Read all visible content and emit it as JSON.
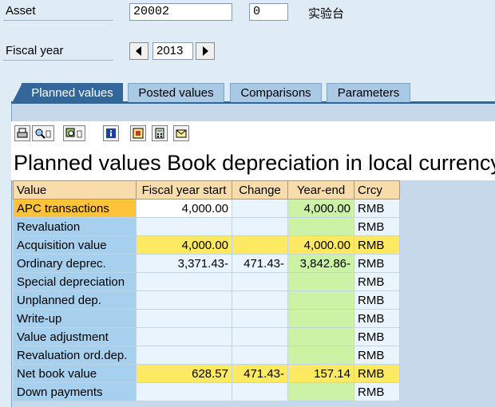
{
  "header": {
    "asset_label": "Asset",
    "asset_number": "20002",
    "sub_number": "0",
    "asset_description": "实验台",
    "fiscal_year_label": "Fiscal year",
    "fiscal_year": "2013"
  },
  "tabs": [
    {
      "label": "Planned values",
      "active": true
    },
    {
      "label": "Posted values",
      "active": false
    },
    {
      "label": "Comparisons",
      "active": false
    },
    {
      "label": "Parameters",
      "active": false
    }
  ],
  "toolbar": {
    "icons": [
      "print-icon",
      "find-icon",
      "find-next-icon",
      "info-icon",
      "export-icon",
      "calculator-icon",
      "mail-icon"
    ]
  },
  "report": {
    "title": "Planned values Book depreciation in local currency"
  },
  "table": {
    "headers": [
      "Value",
      "Fiscal year start",
      "Change",
      "Year-end",
      "Crcy"
    ],
    "rows": [
      {
        "label": "APC transactions",
        "start": "4,000.00",
        "change": "",
        "end": "4,000.00",
        "crcy": "RMB"
      },
      {
        "label": "Revaluation",
        "start": "",
        "change": "",
        "end": "",
        "crcy": "RMB"
      },
      {
        "label": "Acquisition value",
        "start": "4,000.00",
        "change": "",
        "end": "4,000.00",
        "crcy": "RMB"
      },
      {
        "label": "Ordinary deprec.",
        "start": "3,371.43-",
        "change": "471.43-",
        "end": "3,842.86-",
        "crcy": "RMB"
      },
      {
        "label": "Special depreciation",
        "start": "",
        "change": "",
        "end": "",
        "crcy": "RMB"
      },
      {
        "label": "Unplanned dep.",
        "start": "",
        "change": "",
        "end": "",
        "crcy": "RMB"
      },
      {
        "label": "Write-up",
        "start": "",
        "change": "",
        "end": "",
        "crcy": "RMB"
      },
      {
        "label": "Value adjustment",
        "start": "",
        "change": "",
        "end": "",
        "crcy": "RMB"
      },
      {
        "label": "Revaluation ord.dep.",
        "start": "",
        "change": "",
        "end": "",
        "crcy": "RMB"
      },
      {
        "label": "Net book value",
        "start": "628.57",
        "change": "471.43-",
        "end": "157.14",
        "crcy": "RMB"
      },
      {
        "label": "Down payments",
        "start": "",
        "change": "",
        "end": "",
        "crcy": "RMB"
      }
    ]
  },
  "colors": {
    "tab_active": "#336699",
    "tab_inactive": "#a9c9e4",
    "row_label": "#a7cfee",
    "row_label_selected": "#ffc23a",
    "header_cell": "#f8dcab",
    "total_row": "#fde962",
    "year_end_col": "#cbf2a5"
  }
}
